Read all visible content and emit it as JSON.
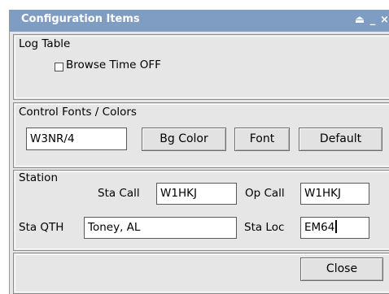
{
  "window": {
    "title": "Configuration Items",
    "controls": {
      "shade": "⏏",
      "minimize": "_",
      "close": "×"
    }
  },
  "log_table": {
    "label": "Log Table",
    "browse_time": {
      "label": "Browse Time OFF",
      "checked": false
    }
  },
  "fonts_colors": {
    "label": "Control Fonts / Colors",
    "sample_value": "W3NR/4",
    "bg_color_button": "Bg Color",
    "font_button": "Font",
    "default_button": "Default"
  },
  "station": {
    "label": "Station",
    "sta_call_label": "Sta Call",
    "sta_call_value": "W1HKJ",
    "op_call_label": "Op Call",
    "op_call_value": "W1HKJ",
    "sta_qth_label": "Sta QTH",
    "sta_qth_value": "Toney, AL",
    "sta_loc_label": "Sta Loc",
    "sta_loc_value": "EM64"
  },
  "footer": {
    "close_button": "Close"
  },
  "colors": {
    "titlebar": "#7f9cc2",
    "window_bg": "#e6e6e6"
  }
}
